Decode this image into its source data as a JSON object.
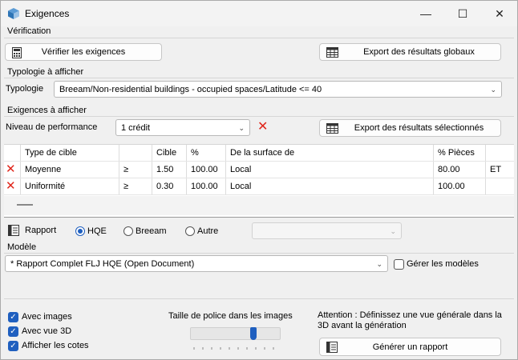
{
  "window": {
    "title": "Exigences",
    "minimize": "—",
    "maximize": "☐",
    "close": "✕"
  },
  "verification": {
    "label": "Vérification",
    "check_button": "Vérifier les exigences",
    "export_global_button": "Export des résultats globaux"
  },
  "typology": {
    "section_label": "Typologie à afficher",
    "field_label": "Typologie",
    "value": "Breeam/Non-residential buildings - occupied spaces/Latitude <= 40"
  },
  "requirements": {
    "section_label": "Exigences à afficher",
    "level_label": "Niveau de performance",
    "level_value": "1 crédit",
    "export_selected_button": "Export des résultats sélectionnés",
    "columns": [
      "Type de cible",
      "",
      "Cible",
      "%",
      "De la surface de",
      "% Pièces",
      ""
    ],
    "rows": [
      {
        "type": "Moyenne",
        "op": "≥",
        "target": "1.50",
        "pct": "100.00",
        "surface": "Local",
        "rooms": "80.00",
        "logic": "ET"
      },
      {
        "type": "Uniformité",
        "op": "≥",
        "target": "0.30",
        "pct": "100.00",
        "surface": "Local",
        "rooms": "100.00",
        "logic": ""
      }
    ]
  },
  "report": {
    "label": "Rapport",
    "options": [
      "HQE",
      "Breeam",
      "Autre"
    ],
    "selected": "HQE"
  },
  "model": {
    "section_label": "Modèle",
    "value": "* Rapport Complet FLJ HQE (Open Document)",
    "manage_label": "Gérer les modèles"
  },
  "options": {
    "with_images": "Avec images",
    "with_3d": "Avec vue 3D",
    "show_dims": "Afficher les cotes",
    "font_size_label": "Taille de police dans les images",
    "font_size_level": 0.72
  },
  "attention": "Attention : Définissez une vue générale dans la 3D avant la génération",
  "generate_button": "Générer un rapport",
  "colors": {
    "accent": "#1f5fbf",
    "error": "#e0261b"
  }
}
